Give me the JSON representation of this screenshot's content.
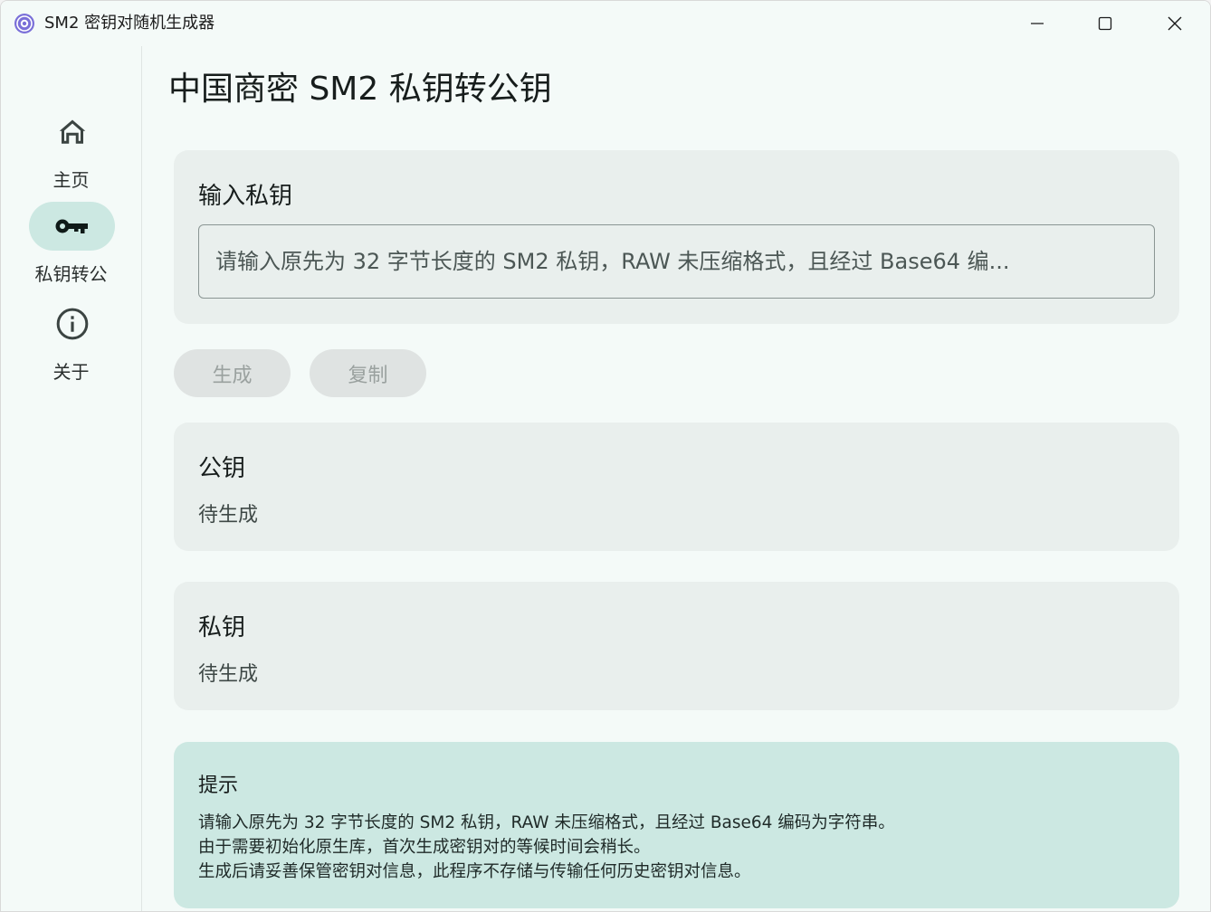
{
  "window": {
    "title": "SM2 密钥对随机生成器"
  },
  "sidebar": {
    "items": [
      {
        "label": "主页",
        "icon": "home-icon",
        "active": false
      },
      {
        "label": "私钥转公",
        "icon": "key-icon",
        "active": true
      },
      {
        "label": "关于",
        "icon": "info-icon",
        "active": false
      }
    ]
  },
  "main": {
    "title": "中国商密 SM2 私钥转公钥",
    "input_card": {
      "label": "输入私钥",
      "placeholder": "请输入原先为 32 字节长度的 SM2 私钥，RAW 未压缩格式，且经过 Base64 编...",
      "value": ""
    },
    "buttons": {
      "generate": "生成",
      "copy": "复制"
    },
    "public_key": {
      "label": "公钥",
      "value": "待生成"
    },
    "private_key": {
      "label": "私钥",
      "value": "待生成"
    },
    "tip": {
      "label": "提示",
      "lines": [
        "请输入原先为 32 字节长度的 SM2 私钥，RAW 未压缩格式，且经过 Base64 编码为字符串。",
        "由于需要初始化原生库，首次生成密钥对的等候时间会稍长。",
        "生成后请妥善保管密钥对信息，此程序不存储与传输任何历史密钥对信息。"
      ]
    }
  },
  "colors": {
    "background": "#f4faf8",
    "card": "#e9efed",
    "tip_card": "#cce8e2",
    "active_pill": "#cce8e2",
    "disabled_button": "#dfe3e2"
  }
}
